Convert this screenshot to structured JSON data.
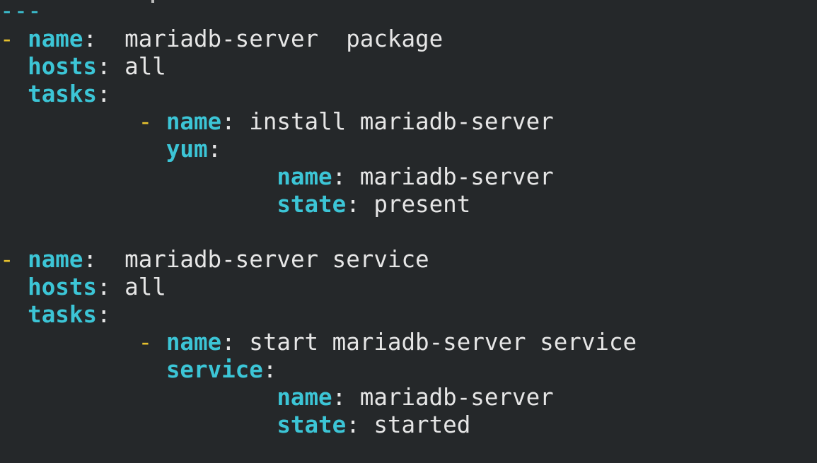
{
  "document_start": "---",
  "plays": [
    {
      "dash": "-",
      "name_key": "name",
      "name_value": " mariadb-server  package",
      "hosts_key": "hosts",
      "hosts_value": "all",
      "tasks_key": "tasks",
      "task": {
        "dash": "-",
        "name_key": "name",
        "name_value": "install mariadb-server",
        "module_key": "yum",
        "params": [
          {
            "key": "name",
            "value": "mariadb-server"
          },
          {
            "key": "state",
            "value": "present"
          }
        ]
      }
    },
    {
      "dash": "-",
      "name_key": "name",
      "name_value": " mariadb-server service",
      "hosts_key": "hosts",
      "hosts_value": "all",
      "tasks_key": "tasks",
      "task": {
        "dash": "-",
        "name_key": "name",
        "name_value": "start mariadb-server service",
        "module_key": "service",
        "params": [
          {
            "key": "name",
            "value": "mariadb-server"
          },
          {
            "key": "state",
            "value": "started"
          }
        ]
      }
    }
  ]
}
